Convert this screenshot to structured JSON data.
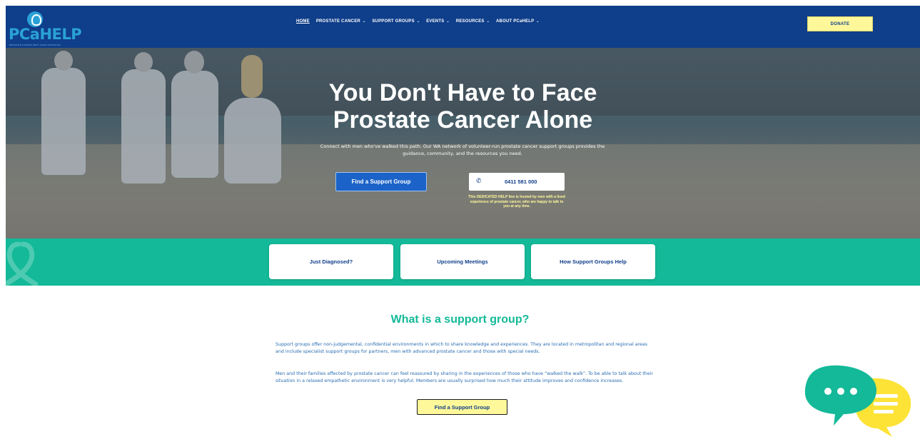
{
  "header": {
    "logo_text": "PCaHELP",
    "logo_subtitle": "PROSTATE CANCER HELP ASSOCIATION INC",
    "nav": [
      {
        "label": "HOME",
        "active": true,
        "dropdown": false
      },
      {
        "label": "PROSTATE CANCER",
        "active": false,
        "dropdown": true
      },
      {
        "label": "SUPPORT GROUPS",
        "active": false,
        "dropdown": true
      },
      {
        "label": "EVENTS",
        "active": false,
        "dropdown": true
      },
      {
        "label": "RESOURCES",
        "active": false,
        "dropdown": true
      },
      {
        "label": "ABOUT PCaHELP",
        "active": false,
        "dropdown": true
      }
    ],
    "chevron": "⌄",
    "donate_label": "DONATE"
  },
  "hero": {
    "title_line1": "You Don't Have to Face",
    "title_line2": "Prostate Cancer Alone",
    "subtitle": "Connect with men who've walked this path. Our WA network of volunteer-run prostate cancer support groups provides the guidance, community, and the resources you need.",
    "cta_label": "Find a Support Group",
    "phone_icon": "phone-icon",
    "phone_number": "0411 581 000",
    "phone_note": "This DEDICATED HELP line is hosted by men with a lived experience of prostate cancer, who are happy to talk to you at any time."
  },
  "cards": [
    {
      "label": "Just Diagnosed?"
    },
    {
      "label": "Upcoming Meetings"
    },
    {
      "label": "How Support Groups Help"
    }
  ],
  "content": {
    "heading": "What is a support group?",
    "paragraph1": "Support groups offer non-judgemental, confidential environments in which to share knowledge and experiences. They are located in metropolitan and regional areas and include specialist support groups for partners, men with advanced prostate cancer and those with special needs.",
    "paragraph2": "Men and their families affected by prostate cancer can feel reassured by sharing in the experiences of those who have “walked the walk”. To be able to talk about their situation in a relaxed empathetic environment is very helpful. Members are usually surprised how much their attitude improves and confidence increases.",
    "cta_label": "Find a Support Group"
  },
  "colors": {
    "header_bg": "#0f3e8a",
    "accent_teal": "#13b998",
    "donate_yellow": "#fff89a",
    "button_blue": "#1b63c8",
    "text_blue": "#2a6db2"
  }
}
